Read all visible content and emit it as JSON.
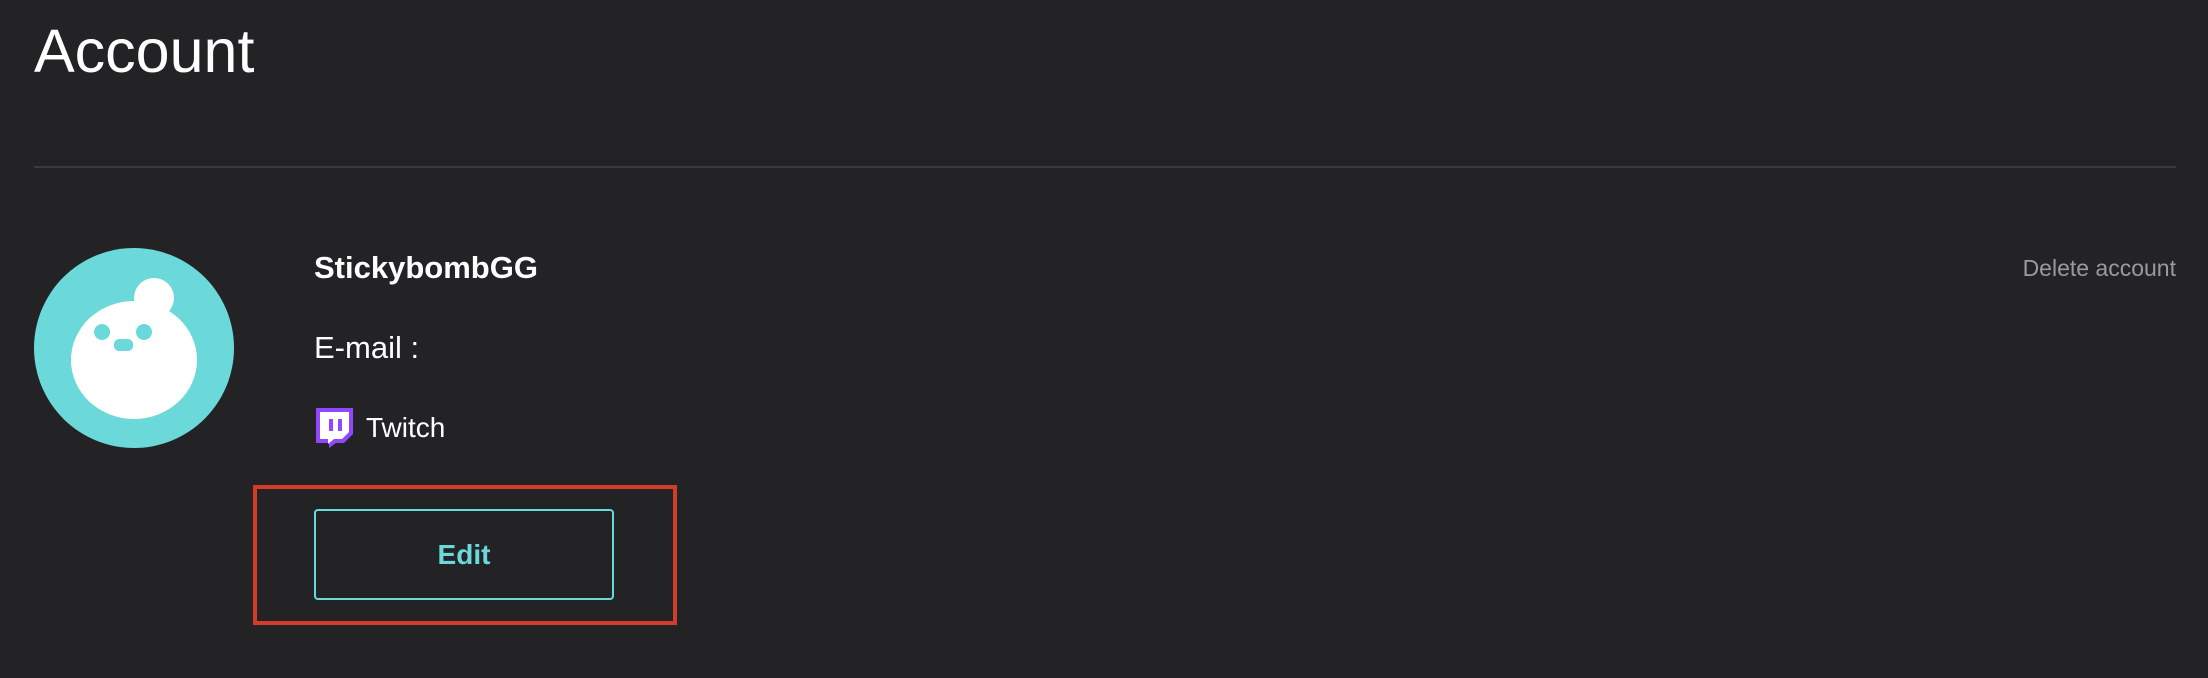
{
  "page": {
    "title": "Account"
  },
  "profile": {
    "username": "StickybombGG",
    "email_label": "E-mail :",
    "provider": {
      "name": "Twitch",
      "icon": "twitch-icon",
      "color": "#9146ff"
    },
    "avatar_icon": "mascot-avatar-icon"
  },
  "actions": {
    "delete_label": "Delete account",
    "edit_label": "Edit"
  },
  "colors": {
    "background": "#232325",
    "accent": "#6bd8da",
    "muted_text": "#9a9a9e",
    "highlight": "#d43c2a"
  }
}
